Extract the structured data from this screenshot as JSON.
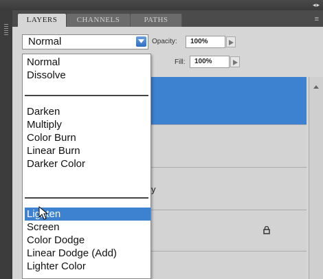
{
  "tabs": [
    {
      "label": "LAYERS",
      "active": true
    },
    {
      "label": "CHANNELS",
      "active": false
    },
    {
      "label": "PATHS",
      "active": false
    }
  ],
  "blend_mode": {
    "value": "Normal"
  },
  "opacity": {
    "label": "Opacity:",
    "value": "100%"
  },
  "fill": {
    "label": "Fill:",
    "value": "100%"
  },
  "blend_menu": {
    "group1": [
      "Normal",
      "Dissolve"
    ],
    "group2": [
      "Darken",
      "Multiply",
      "Color Burn",
      "Linear Burn",
      "Darker Color"
    ],
    "group3": [
      "Lighten",
      "Screen",
      "Color Dodge",
      "Linear Dodge (Add)",
      "Lighter Color"
    ],
    "selected": "Lighten"
  },
  "layers": [
    {
      "partial_name": "",
      "selected": true,
      "locked": false
    },
    {
      "partial_name": "",
      "selected": false,
      "locked": false
    },
    {
      "partial_name": "y",
      "selected": false,
      "locked": false
    },
    {
      "partial_name": "",
      "selected": false,
      "locked": true
    },
    {
      "partial_name": "",
      "selected": false,
      "locked": false
    }
  ],
  "colors": {
    "selection": "#3d82d0",
    "panel_bg": "#d6d6d6",
    "tabbar_bg": "#4b4b4b"
  },
  "icons": {
    "dropdown": "chevron-down-icon",
    "spin": "arrow-right-icon",
    "lock": "lock-icon",
    "cursor": "pointer-cursor-icon",
    "menu": "panel-menu-icon"
  }
}
